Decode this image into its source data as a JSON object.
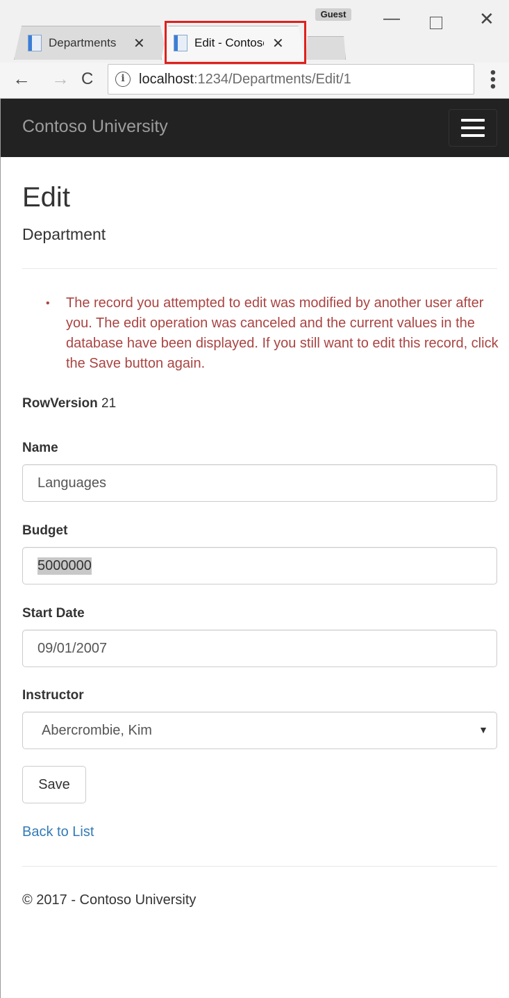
{
  "browser": {
    "tabs": [
      {
        "title": "Departments",
        "active": false
      },
      {
        "title": "Edit - Contoso",
        "active": true
      }
    ],
    "profile_label": "Guest",
    "address": {
      "host": "localhost",
      "rest": ":1234/Departments/Edit/1"
    },
    "icons": {
      "back": "←",
      "forward": "→",
      "reload": "C",
      "info": "i",
      "menu": "⋮",
      "minimize": "—",
      "close": "✕",
      "tab_close": "✕"
    }
  },
  "navbar": {
    "brand": "Contoso University"
  },
  "page": {
    "title": "Edit",
    "subtitle": "Department",
    "validation_errors": [
      "The record you attempted to edit was modified by another user after you. The edit operation was canceled and the current values in the database have been displayed. If you still want to edit this record, click the Save button again."
    ],
    "rowversion": {
      "label": "RowVersion",
      "value": "21"
    },
    "fields": {
      "name": {
        "label": "Name",
        "value": "Languages"
      },
      "budget": {
        "label": "Budget",
        "value": "5000000"
      },
      "start_date": {
        "label": "Start Date",
        "value": "09/01/2007"
      },
      "instructor": {
        "label": "Instructor",
        "value": "Abercrombie, Kim"
      }
    },
    "save_label": "Save",
    "back_link": "Back to List"
  },
  "footer": {
    "text": "© 2017 - Contoso University"
  },
  "colors": {
    "navbar_bg": "#222222",
    "brand": "#9d9d9d",
    "error_text": "#a94442",
    "link": "#337ab7",
    "highlight_box": "#e0201c"
  }
}
